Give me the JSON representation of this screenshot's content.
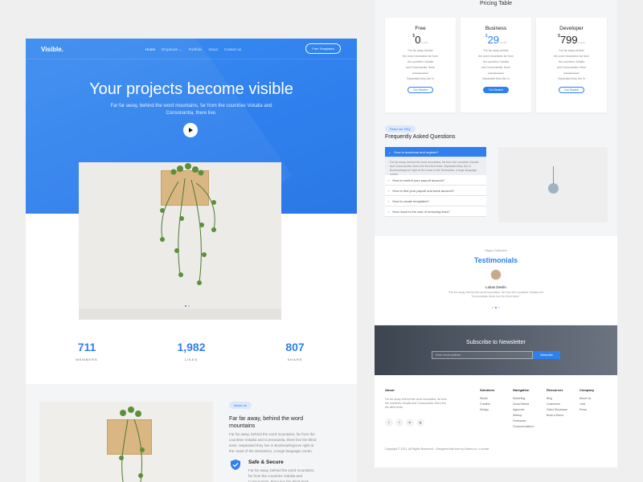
{
  "left": {
    "logo": "Visible.",
    "nav": [
      {
        "label": "Home",
        "active": true
      },
      {
        "label": "Dropdown ⌄",
        "active": false
      },
      {
        "label": "Portfolio",
        "active": false
      },
      {
        "label": "About",
        "active": false
      },
      {
        "label": "Contact us",
        "active": false
      }
    ],
    "cta": "Free Templates",
    "hero_title": "Your projects become visible",
    "hero_sub": "Far far away, behind the word mountains, far from the countries Vokalia and Consonantia, there live.",
    "stats": [
      {
        "value": "711",
        "label": "MEMBERS"
      },
      {
        "value": "1,982",
        "label": "LIKES"
      },
      {
        "value": "807",
        "label": "SHARE"
      }
    ],
    "about_pill": "About us",
    "about_title": "Far far away, behind the word mountains",
    "about_text": "Far far away, behind the word mountains, far from the countries Vokalia and Consonantia, there live the blind texts. Separated they live in Bookmarksgrove right at the coast of the Semantics, a large language ocean.",
    "safe_title": "Safe & Secure",
    "safe_text": "Far far away, behind the word mountains, far from the countries Vokalia and Consonantia, there live the blind texts."
  },
  "right": {
    "pricing_title": "Pricing Table",
    "plans": [
      {
        "name": "Free",
        "price": "0",
        "features": [
          "Far far away behind",
          "the word mountains far from",
          "the countries Vokalia",
          "and Consonantia, there",
          "live the blind",
          "Separated they live in"
        ],
        "button": "Get Started"
      },
      {
        "name": "Business",
        "price": "29",
        "features": [
          "Far far away behind",
          "the word mountains far from",
          "the countries Vokalia",
          "and Consonantia, there",
          "live the blind",
          "Separated they live in"
        ],
        "button": "Get Started"
      },
      {
        "name": "Developer",
        "price": "799",
        "features": [
          "Far far away behind",
          "the word mountains far from",
          "the countries Vokalia",
          "and Consonantia, there",
          "live the blind",
          "Separated they live in"
        ],
        "button": "Get Started"
      }
    ],
    "currency": "$",
    "period": "/month",
    "faq_pill": "Read our FAQ",
    "faq_title": "Frequently Asked Questions",
    "faq_items": [
      "How to download and register?",
      "How to control your payroll account?",
      "How to find your payroll and bank account?",
      "How to create templates?",
      "How much is the cost of removing links?"
    ],
    "faq_answer": "Far far away, behind the word mountains, far from the countries Vokalia and Consonantia, there live the blind texts. Separated they live in Bookmarksgrove right at the coast of the Semantics, a large language ocean.",
    "testi_small": "Happy Customers",
    "testi_title": "Testimonials",
    "testi_name": "Lukas Devlin",
    "testi_quote": "“Far far away, behind the word mountains, far from the countries Vokalia and Consonantia, there live the blind texts.”",
    "newsletter_title": "Subscribe to Newsletter",
    "newsletter_placeholder": "Enter email address",
    "newsletter_button": "Subscribe",
    "footer": {
      "about_head": "About",
      "about_text": "Far far away, behind the word mountains, far from the countries Vokalia and Consonantia, there live the blind texts.",
      "socials": [
        "t",
        "f",
        "in",
        "ig"
      ],
      "cols": [
        {
          "head": "Solutions",
          "items": [
            "Studio",
            "Creative",
            "Design"
          ]
        },
        {
          "head": "Navigation",
          "items": [
            "Marketing",
            "Social Media",
            "Agencies",
            "Startup",
            "Freelancer",
            "Communications"
          ]
        },
        {
          "head": "Resources",
          "items": [
            "Blog",
            "Customers",
            "Video Showcase",
            "Book a Demo"
          ]
        },
        {
          "head": "Company",
          "items": [
            "About Us",
            "Jobs",
            "Press"
          ]
        }
      ],
      "copyright": "Copyright © 2021. All Rights Reserved. • Designed with love by Untree.co • License"
    }
  }
}
